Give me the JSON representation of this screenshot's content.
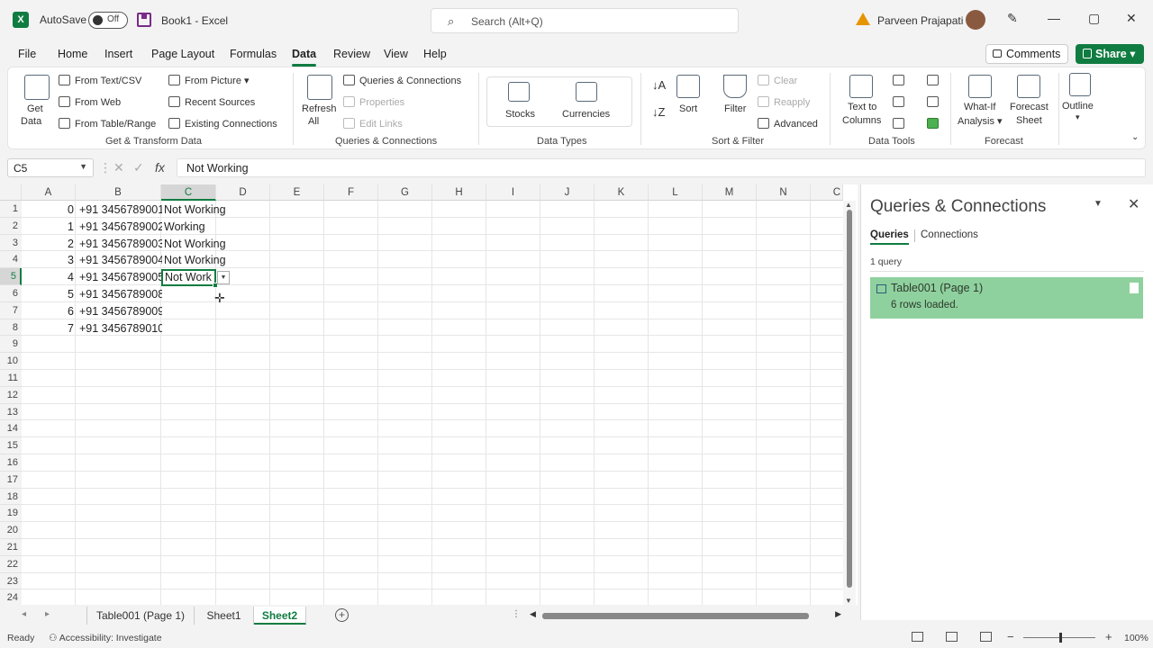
{
  "titlebar": {
    "autosave_label": "AutoSave",
    "autosave_state": "Off",
    "doc_title": "Book1 - Excel",
    "search_placeholder": "Search (Alt+Q)",
    "user_name": "Parveen Prajapati"
  },
  "menu": [
    "File",
    "Home",
    "Insert",
    "Page Layout",
    "Formulas",
    "Data",
    "Review",
    "View",
    "Help"
  ],
  "active_menu": "Data",
  "header_buttons": {
    "comments": "Comments",
    "share": "Share"
  },
  "ribbon": {
    "get_data": "Get",
    "get_data2": "Data",
    "from_text_csv": "From Text/CSV",
    "from_web": "From Web",
    "from_table_range": "From Table/Range",
    "from_picture": "From Picture",
    "recent_sources": "Recent Sources",
    "existing_connections": "Existing Connections",
    "group_get_transform": "Get & Transform Data",
    "refresh": "Refresh",
    "refresh2": "All",
    "queries_connections": "Queries & Connections",
    "properties": "Properties",
    "edit_links": "Edit Links",
    "group_queries": "Queries & Connections",
    "stocks": "Stocks",
    "currencies": "Currencies",
    "group_datatypes": "Data Types",
    "sort": "Sort",
    "filter": "Filter",
    "clear": "Clear",
    "reapply": "Reapply",
    "advanced": "Advanced",
    "group_sortfilter": "Sort & Filter",
    "text_to_columns": "Text to",
    "text_to_columns2": "Columns",
    "group_datatools": "Data Tools",
    "whatif": "What-If",
    "whatif2": "Analysis",
    "forecast_sheet": "Forecast",
    "forecast_sheet2": "Sheet",
    "group_forecast": "Forecast",
    "outline": "Outline"
  },
  "formula_bar": {
    "name_box": "C5",
    "formula": "Not Working"
  },
  "columns": [
    "A",
    "B",
    "C",
    "D",
    "E",
    "F",
    "G",
    "H",
    "I",
    "J",
    "K",
    "L",
    "M",
    "N",
    "C"
  ],
  "rows": [
    "1",
    "2",
    "3",
    "4",
    "5",
    "6",
    "7",
    "8",
    "9",
    "10",
    "11",
    "12",
    "13",
    "14",
    "15",
    "16",
    "17",
    "18",
    "19",
    "20",
    "21",
    "22",
    "23",
    "24"
  ],
  "cells": [
    {
      "a": "0",
      "b": "+91 3456789001",
      "c": "Not Working"
    },
    {
      "a": "1",
      "b": "+91 3456789002",
      "c": "Working"
    },
    {
      "a": "2",
      "b": "+91 3456789003",
      "c": "Not Working"
    },
    {
      "a": "3",
      "b": "+91 3456789004",
      "c": "Not Working"
    },
    {
      "a": "4",
      "b": "+91 3456789005",
      "c": "Not Working"
    },
    {
      "a": "5",
      "b": "+91 3456789008",
      "c": ""
    },
    {
      "a": "6",
      "b": "+91 3456789009",
      "c": ""
    },
    {
      "a": "7",
      "b": "+91 3456789010",
      "c": ""
    }
  ],
  "active_cell_text": "Not Work",
  "pane": {
    "title": "Queries & Connections",
    "tab_queries": "Queries",
    "tab_connections": "Connections",
    "count": "1 query",
    "query_name": "Table001 (Page 1)",
    "query_status": "6 rows loaded."
  },
  "sheets": [
    "Table001 (Page 1)",
    "Sheet1",
    "Sheet2"
  ],
  "active_sheet": "Sheet2",
  "status": {
    "ready": "Ready",
    "accessibility": "Accessibility: Investigate",
    "zoom": "100%"
  },
  "colors": {
    "accent": "#107c41",
    "query_highlight": "#8fd19e"
  }
}
